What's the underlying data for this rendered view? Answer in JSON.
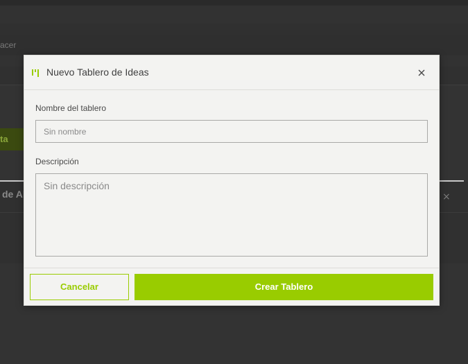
{
  "background": {
    "partial_text": "acer",
    "green_button_partial": "ta",
    "section_partial_title": "de Al",
    "close_glyph": "×"
  },
  "modal": {
    "title": "Nuevo Tablero de Ideas",
    "icon": "board-icon",
    "close_icon": "close-icon",
    "fields": {
      "name_label": "Nombre del tablero",
      "name_placeholder": "Sin nombre",
      "name_value": "",
      "description_label": "Descripción",
      "description_placeholder": "Sin descripción",
      "description_value": ""
    },
    "buttons": {
      "cancel_label": "Cancelar",
      "create_label": "Crear Tablero"
    }
  },
  "colors": {
    "accent": "#99cc00",
    "modal_bg": "#f3f3f1",
    "overlay_bg": "#333333"
  }
}
